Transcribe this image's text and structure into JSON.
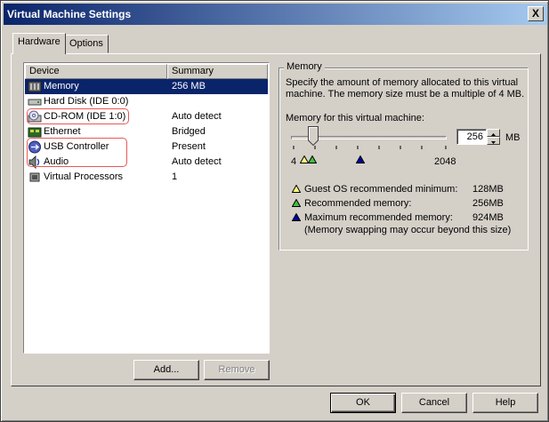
{
  "window": {
    "title": "Virtual Machine Settings",
    "close_label": "X"
  },
  "tabs": [
    {
      "label": "Hardware",
      "active": true
    },
    {
      "label": "Options",
      "active": false
    }
  ],
  "device_list": {
    "columns": [
      "Device",
      "Summary"
    ],
    "rows": [
      {
        "name": "Memory",
        "summary": "256 MB",
        "icon": "memory-icon",
        "selected": true
      },
      {
        "name": "Hard Disk (IDE 0:0)",
        "summary": "",
        "icon": "hard-disk-icon"
      },
      {
        "name": "CD-ROM (IDE 1:0)",
        "summary": "Auto detect",
        "icon": "cdrom-icon"
      },
      {
        "name": "Ethernet",
        "summary": "Bridged",
        "icon": "ethernet-icon"
      },
      {
        "name": "USB Controller",
        "summary": "Present",
        "icon": "usb-icon"
      },
      {
        "name": "Audio",
        "summary": "Auto detect",
        "icon": "audio-icon"
      },
      {
        "name": "Virtual Processors",
        "summary": "1",
        "icon": "processor-icon"
      }
    ]
  },
  "buttons": {
    "add": "Add...",
    "remove": "Remove",
    "ok": "OK",
    "cancel": "Cancel",
    "help": "Help"
  },
  "memory": {
    "group_title": "Memory",
    "description_1": "Specify the amount of memory allocated to this virtual",
    "description_2": "machine. The memory size must be a multiple of 4 MB.",
    "field_label": "Memory for this virtual machine:",
    "value": "256",
    "unit": "MB",
    "slider_min": "4",
    "slider_max": "2048",
    "legend": [
      {
        "label": "Guest OS recommended minimum:",
        "value": "128MB",
        "color": "#ffff80"
      },
      {
        "label": "Recommended memory:",
        "value": "256MB",
        "color": "#40c040"
      },
      {
        "label": "Maximum recommended memory:",
        "value": "924MB",
        "color": "#0000a0"
      }
    ],
    "swap_note": "(Memory swapping may occur beyond this size)"
  },
  "colors": {
    "selection": "#0a246a",
    "highlight": "#e8585a",
    "face": "#d4d0c8"
  }
}
